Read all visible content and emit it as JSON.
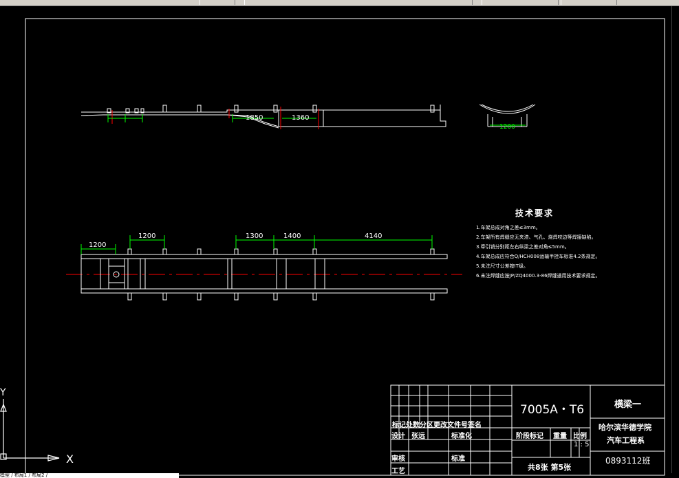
{
  "colors": {
    "line": "#ffffff",
    "dimension": "#00ff00",
    "centerline": "#ff0000",
    "background": "#000000"
  },
  "dimensions": {
    "side_view": [
      "1850",
      "1360"
    ],
    "end_view": [
      "1200"
    ],
    "top_view": [
      "1200",
      "1200",
      "1300",
      "1400",
      "4140"
    ]
  },
  "tech_requirements": {
    "title": "技术要求",
    "items": [
      "1.车架总成对角之差≤3mm。",
      "2.车架所有焊缝应无夹渣、气孔、烧焊咬边等焊接缺陷。",
      "3.牵引销分别距左右纵梁之差对角≤5mm。",
      "4.车架总成应符合Q/HCH008运输半挂车标准4.2条规定。",
      "5.未注尺寸公差按IT级。",
      "6.未注焊缝应按JP/ZQ4000.3-86焊缝通用技术要求规定。"
    ]
  },
  "title_block": {
    "drawing_number": "7005A・T6",
    "part_name": "横梁一",
    "school": "哈尔滨华德学院",
    "department": "汽车工程系",
    "student_id": "0893112班",
    "scale": "1 : 5",
    "sheets": "共8张 第5张",
    "col_headers": "标记处数分区更改文件号签名",
    "design": "设计",
    "design_name": "张远",
    "standard": "标准化",
    "stage_mark": "阶段标记",
    "weight": "重量",
    "ratio": "比例",
    "review": "审核",
    "process": "工艺",
    "approve": "标准"
  },
  "ucs": {
    "x_label": "X",
    "y_label": "Y"
  },
  "status_text": "模型 / 布局1 / 布局2 /"
}
